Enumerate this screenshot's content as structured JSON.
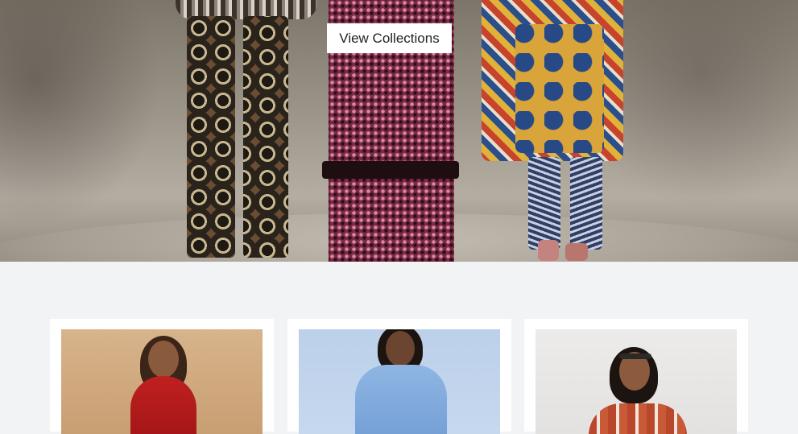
{
  "hero": {
    "cta_label": "View Collections"
  },
  "cards": [
    {
      "image": "model-red-dress"
    },
    {
      "image": "model-blue-dress"
    },
    {
      "image": "model-striped-top"
    }
  ],
  "colors": {
    "page_bg": "#f2f3f5",
    "card_bg": "#ffffff",
    "cta_bg": "#ffffff",
    "cta_text": "#222222"
  }
}
